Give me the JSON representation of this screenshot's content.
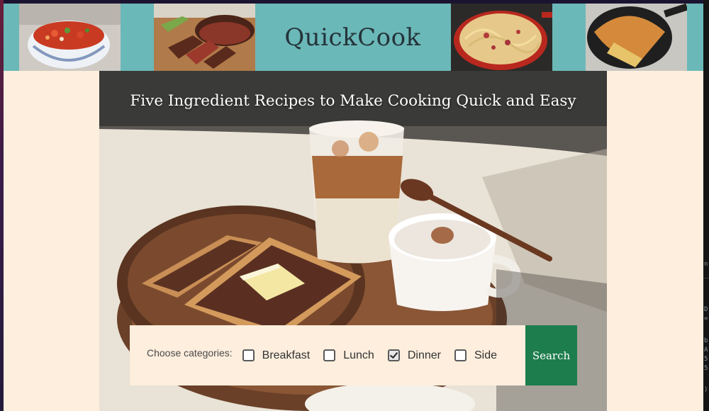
{
  "header": {
    "site_title": "QuickCook",
    "banner_color": "#6bb8b8",
    "photos": [
      "salsa-photo",
      "steak-photo",
      "pasta-photo",
      "cornbread-photo"
    ]
  },
  "hero": {
    "tagline": "Five Ingredient Recipes to Make Cooking Quick and Easy",
    "image": "breakfast-tray-photo"
  },
  "search": {
    "label": "Choose categories:",
    "categories": [
      {
        "label": "Breakfast",
        "checked": false
      },
      {
        "label": "Lunch",
        "checked": false
      },
      {
        "label": "Dinner",
        "checked": true
      },
      {
        "label": "Side",
        "checked": false
      }
    ],
    "button_label": "Search",
    "button_color": "#1e7d4d"
  },
  "background_color": "#fdeedd"
}
